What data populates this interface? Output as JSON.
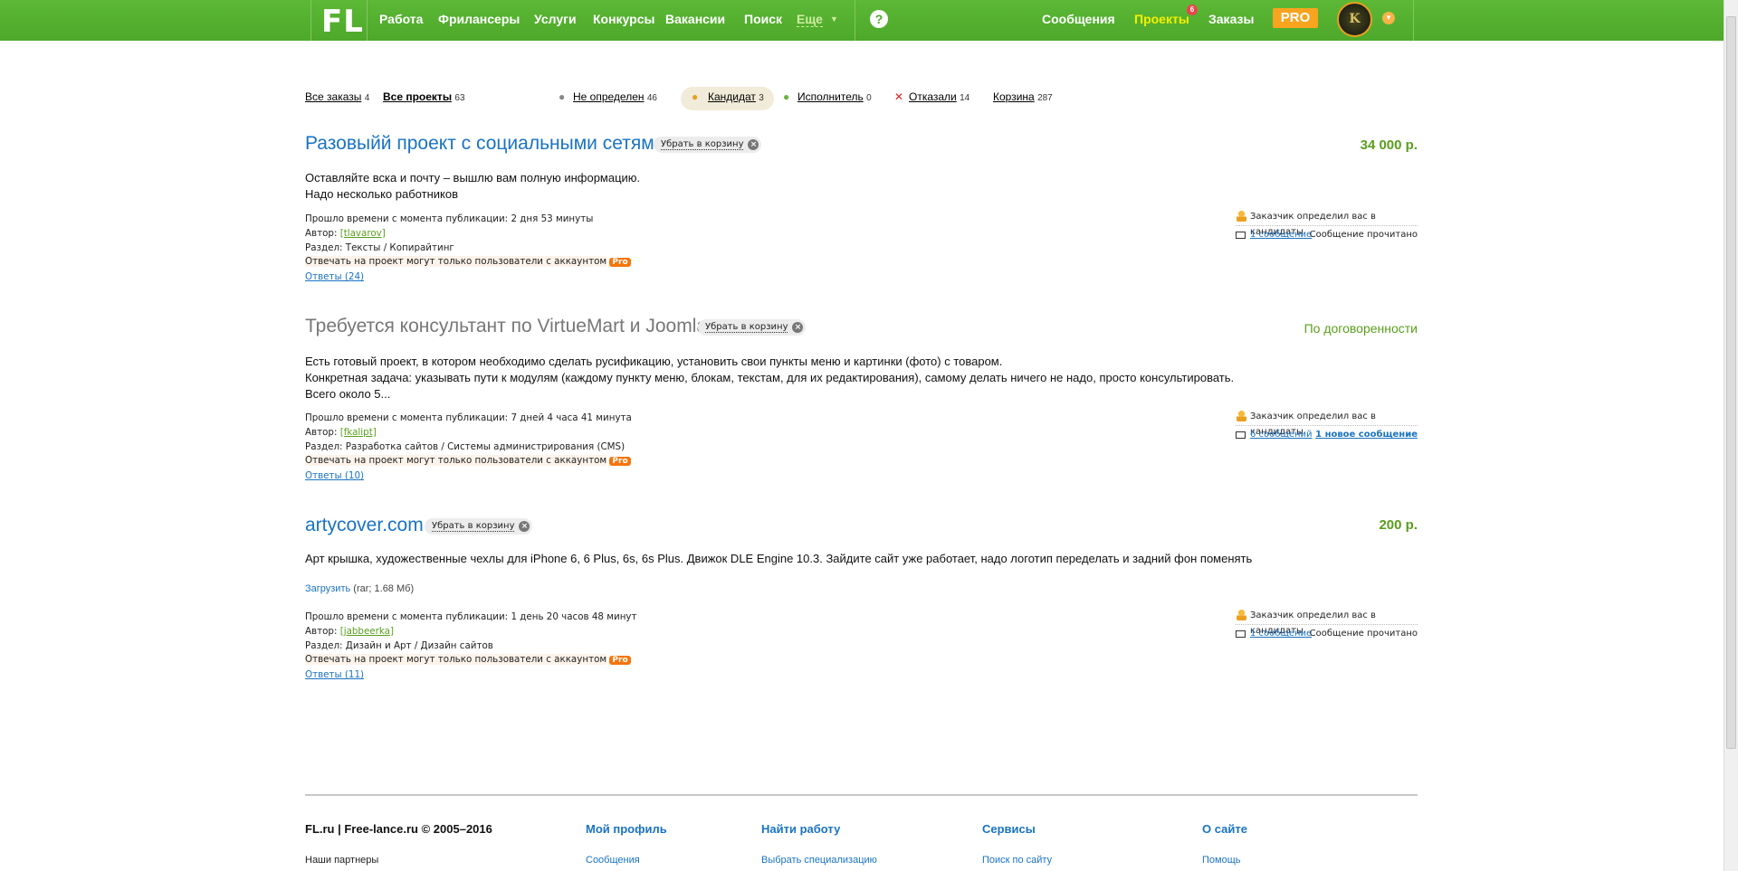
{
  "header": {
    "logo": "FL",
    "nav": [
      "Работа",
      "Фрилансеры",
      "Услуги",
      "Конкурсы",
      "Вакансии",
      "Поиск"
    ],
    "more": "Еще",
    "help": "?",
    "messages": "Сообщения",
    "projects": "Проекты",
    "projects_badge": "6",
    "orders": "Заказы",
    "pro": "PRO",
    "avatar_letter": "K"
  },
  "filters": {
    "all_orders": "Все заказы",
    "all_orders_count": "4",
    "all_projects": "Все проекты",
    "all_projects_count": "63",
    "undefined": "Не определен",
    "undefined_count": "46",
    "candidate": "Кандидат",
    "candidate_count": "3",
    "executor": "Исполнитель",
    "executor_count": "0",
    "refused": "Отказали",
    "refused_count": "14",
    "trash": "Корзина",
    "trash_count": "287"
  },
  "common": {
    "trash_btn": "Убрать в корзину",
    "elapsed_label": "Прошло времени с момента публикации:",
    "author_label": "Автор:",
    "section_label": "Раздел:",
    "restrict": "Отвечать на проект могут только пользователи с аккаунтом",
    "pro_pill": "Pro",
    "candidate_note": "Заказчик определил вас в кандидаты"
  },
  "projects": [
    {
      "title": "Разовыйй проект с социальными сетями",
      "price": "34 000 р.",
      "desc": [
        "Оставляйте вска и почту – вышлю вам полную информацию.",
        "Надо несколько работников"
      ],
      "elapsed": "2 дня 53 минуты",
      "author": "[tlavarov]",
      "section": "Тексты / Копирайтинг",
      "answers": "Ответы (24)",
      "messages": "1 сообщение",
      "msg_status": "Сообщение прочитано"
    },
    {
      "title": "Требуется консультант по VirtueMart и Joomla",
      "price": "По договоренности",
      "desc": [
        "Есть готовый проект, в котором необходимо сделать русификацию, установить свои пункты меню и картинки (фото) с товаром.",
        "Конкретная задача: указывать пути к модулям (каждому пункту меню, блокам, текстам, для их редактирования), самому делать ничего не надо, просто консультировать.",
        "Всего около 5..."
      ],
      "elapsed": "7 дней 4 часа 41 минута",
      "author": "[fkalipt]",
      "section": "Разработка сайтов / Системы администрирования (CMS)",
      "answers": "Ответы (10)",
      "messages": "6 сообщений",
      "msg_status": "1 новое сообщение"
    },
    {
      "title": "artycover.com",
      "price": "200 р.",
      "desc": [
        "Арт крышка, художественные чехлы для iPhone 6, 6 Plus, 6s, 6s Plus. Движок DLE Engine 10.3. Зайдите сайт уже работает, надо логотип переделать и задний фон поменять"
      ],
      "download": "Загрузить",
      "download_info": "(rar; 1.68 Мб)",
      "elapsed": "1 день 20 часов 48 минут",
      "author": "[jabbeerka]",
      "section": "Дизайн и Арт / Дизайн сайтов",
      "answers": "Ответы (11)",
      "messages": "1 сообщение",
      "msg_status": "Сообщение прочитано"
    }
  ],
  "footer": {
    "copyright": "FL.ru | Free-lance.ru © 2005–2016",
    "partners": "Наши партнеры",
    "cols": [
      {
        "title": "Мой профиль",
        "link": "Сообщения"
      },
      {
        "title": "Найти работу",
        "link": "Выбрать специализацию"
      },
      {
        "title": "Сервисы",
        "link": "Поиск по сайту"
      },
      {
        "title": "О сайте",
        "link": "Помощь"
      }
    ]
  }
}
